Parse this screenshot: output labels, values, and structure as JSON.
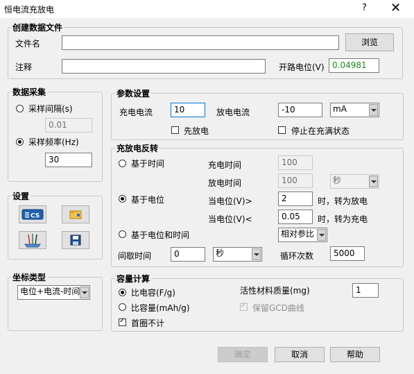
{
  "window": {
    "title": "恒电流充放电",
    "help": "?",
    "close": "✕"
  },
  "create_file": {
    "group_title": "创建数据文件",
    "filename_label": "文件名",
    "filename_value": "",
    "browse_label": "浏览",
    "note_label": "注释",
    "note_value": "",
    "ocp_label": "开路电位(V)",
    "ocp_value": "0.04981"
  },
  "acquisition": {
    "group_title": "数据采集",
    "interval_label": "采样间隔(s)",
    "interval_value": "0.01",
    "freq_label": "采样频率(Hz)",
    "freq_value": "30",
    "selected": "freq"
  },
  "settings": {
    "group_title": "设置",
    "icons": [
      "cs-icon",
      "folder-open-icon",
      "electrode-icon",
      "save-icon"
    ],
    "cs_text": "CS"
  },
  "axis": {
    "group_title": "坐标类型",
    "selected": "电位+电流-时间"
  },
  "params": {
    "group_title": "参数设置",
    "charge_current_label": "充电电流",
    "charge_current_value": "10",
    "discharge_current_label": "放电电流",
    "discharge_current_value": "-10",
    "unit": "mA",
    "first_discharge_label": "先放电",
    "first_discharge_checked": false,
    "stop_full_label": "停止在充满状态",
    "stop_full_checked": false
  },
  "reverse": {
    "group_title": "充放电反转",
    "by_time_label": "基于时间",
    "charge_time_label": "充电时间",
    "charge_time_value": "100",
    "discharge_time_label": "放电时间",
    "discharge_time_value": "100",
    "time_unit": "秒",
    "by_potential_label": "基于电位",
    "pot_gt_label": "当电位(V)>",
    "pot_gt_value": "2",
    "pot_gt_suffix": "时，转为放电",
    "pot_lt_label": "当电位(V)<",
    "pot_lt_value": "0.05",
    "pot_lt_suffix": "时，转为充电",
    "by_pot_time_label": "基于电位和时间",
    "ref_option": "相对参比",
    "interval_label": "间歇时间",
    "interval_value": "0",
    "interval_unit": "秒",
    "cycles_label": "循环次数",
    "cycles_value": "5000",
    "selected": "potential"
  },
  "capacity": {
    "group_title": "容量计算",
    "specific_cap_label": "比电容(F/g)",
    "specific_capacity_label": "比容量(mAh/g)",
    "mass_label": "活性材料质量(mg)",
    "mass_value": "1",
    "keep_gcd_label": "保留GCD曲线",
    "keep_gcd_checked": true,
    "skip_first_label": "首圈不计",
    "skip_first_checked": true,
    "selected": "capacitance"
  },
  "footer": {
    "ok": "确定",
    "cancel": "取消",
    "help": "帮助"
  },
  "colors": {
    "ocp_value": "#1c8a1c",
    "focus": "#0078d7"
  }
}
